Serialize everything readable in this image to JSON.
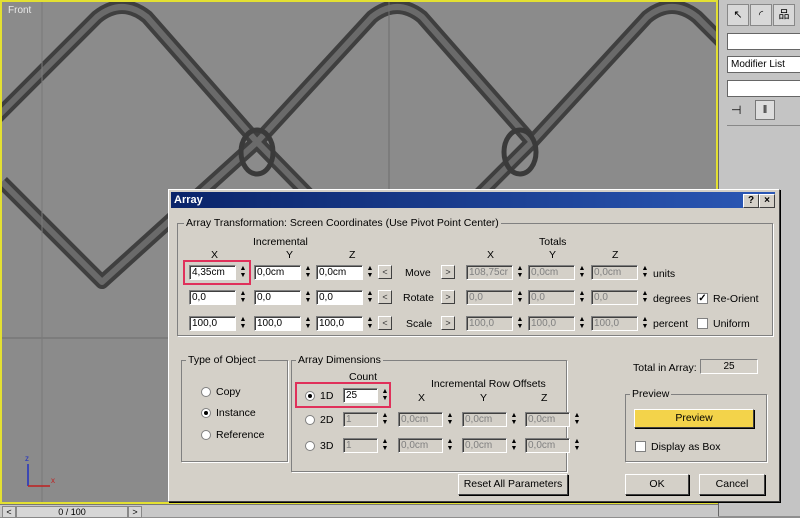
{
  "viewport": {
    "label": "Front"
  },
  "timeline": {
    "frame": "0 / 100",
    "arrow_left": "<",
    "arrow_right": ">"
  },
  "cmdpanel": {
    "modifier_list": "Modifier List"
  },
  "dialog": {
    "title": "Array",
    "help": "?",
    "close": "×",
    "transform_group": "Array Transformation: Screen Coordinates (Use Pivot Point Center)",
    "incremental": "Incremental",
    "totals": "Totals",
    "axes": {
      "x": "X",
      "y": "Y",
      "z": "Z"
    },
    "rows": [
      {
        "label": "Move",
        "unit": "units",
        "inc": [
          "4,35cm",
          "0,0cm",
          "0,0cm"
        ],
        "tot": [
          "108,75cr",
          "0,0cm",
          "0,0cm"
        ]
      },
      {
        "label": "Rotate",
        "unit": "degrees",
        "inc": [
          "0,0",
          "0,0",
          "0,0"
        ],
        "tot": [
          "0,0",
          "0,0",
          "0,0"
        ]
      },
      {
        "label": "Scale",
        "unit": "percent",
        "inc": [
          "100,0",
          "100,0",
          "100,0"
        ],
        "tot": [
          "100,0",
          "100,0",
          "100,0"
        ]
      }
    ],
    "reorient": {
      "label": "Re-Orient",
      "checked": true
    },
    "uniform": {
      "label": "Uniform",
      "checked": false
    },
    "type_group": "Type of Object",
    "types": [
      {
        "label": "Copy",
        "selected": false
      },
      {
        "label": "Instance",
        "selected": true
      },
      {
        "label": "Reference",
        "selected": false
      }
    ],
    "dim_group": "Array Dimensions",
    "count_label": "Count",
    "row_offsets_label": "Incremental Row Offsets",
    "dims": [
      {
        "label": "1D",
        "count": "25",
        "selected": true,
        "offsets": []
      },
      {
        "label": "2D",
        "count": "1",
        "selected": false,
        "offsets": [
          "0,0cm",
          "0,0cm",
          "0,0cm"
        ]
      },
      {
        "label": "3D",
        "count": "1",
        "selected": false,
        "offsets": [
          "0,0cm",
          "0,0cm",
          "0,0cm"
        ]
      }
    ],
    "total_label": "Total in Array:",
    "total_value": "25",
    "preview_group": "Preview",
    "preview_button": "Preview",
    "display_box": {
      "label": "Display as Box",
      "checked": false
    },
    "reset_button": "Reset All Parameters",
    "ok_button": "OK",
    "cancel_button": "Cancel"
  },
  "colors": {
    "viewport_border": "#e3e032",
    "title_bar": "#0a246a",
    "highlight": "#e0305a",
    "preview_button": "#f3d34a"
  }
}
